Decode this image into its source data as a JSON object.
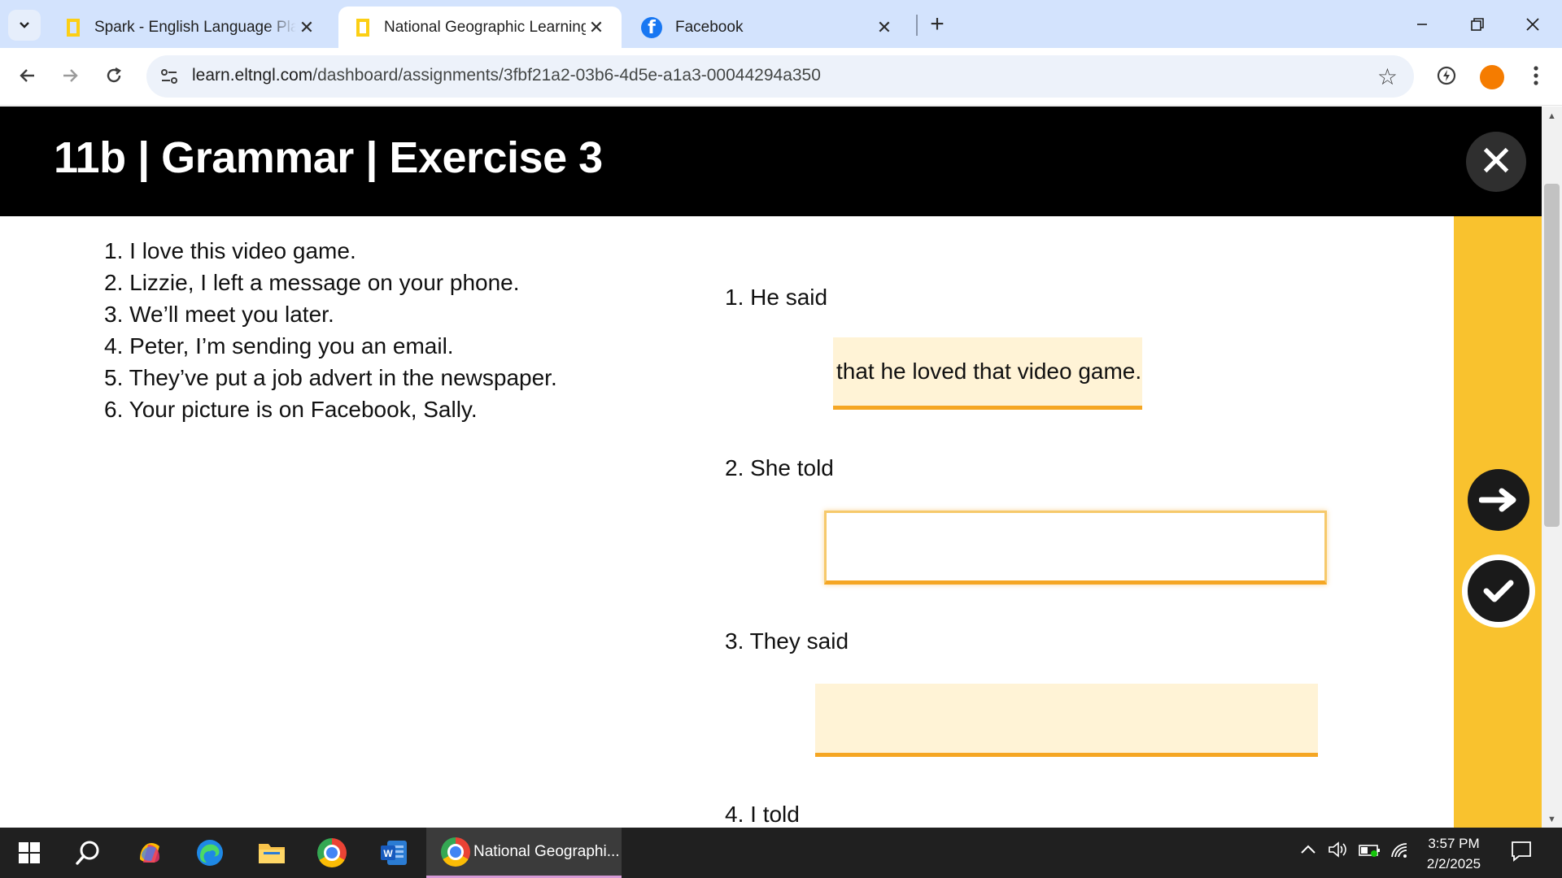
{
  "browser": {
    "tabs": [
      {
        "title": "Spark - English Language Platfo",
        "active": false,
        "icon": "natgeo-icon"
      },
      {
        "title": "National Geographic Learning",
        "active": true,
        "icon": "natgeo-icon"
      },
      {
        "title": "Facebook",
        "active": false,
        "icon": "facebook-icon"
      }
    ],
    "url_host": "learn.eltngl.com",
    "url_path": "/dashboard/assignments/3fbf21a2-03b6-4d5e-a1a3-00044294a350"
  },
  "exercise": {
    "title": "11b | Grammar | Exercise 3",
    "sentences": [
      "1. I love this video game.",
      "2. Lizzie, I left a message on your phone.",
      "3. We’ll meet you later.",
      "4. Peter, I’m sending you an email.",
      "5. They’ve put a job advert in the newspaper.",
      "6. Your picture is on Facebook, Sally."
    ],
    "questions": [
      {
        "label": "1. He said",
        "answer": "that he loved that video game."
      },
      {
        "label": "2. She told",
        "answer": ""
      },
      {
        "label": "3. They said",
        "answer": ""
      },
      {
        "label": "4. I told",
        "answer": ""
      }
    ]
  },
  "colors": {
    "accent_yellow": "#f9c22e",
    "answer_fill": "#fff3d6",
    "answer_underline": "#f5a623",
    "header_bg": "#000000"
  },
  "taskbar": {
    "active_window": "National Geographi...",
    "time": "3:57 PM",
    "date": "2/2/2025"
  }
}
